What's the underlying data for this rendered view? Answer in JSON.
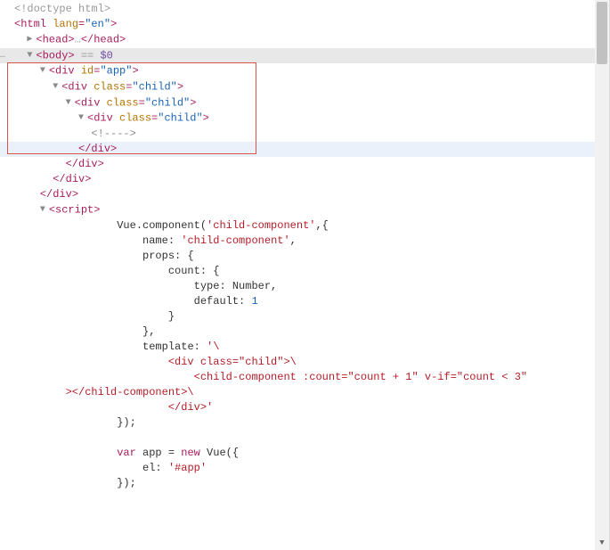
{
  "marker": "…",
  "doctype": "<!doctype html>",
  "html_open": {
    "tag": "html",
    "attr": "lang",
    "val": "\"en\""
  },
  "head": {
    "open": "head",
    "ell": "…",
    "close": "head"
  },
  "body": {
    "tag": "body",
    "eqeq": " == ",
    "var": "$0"
  },
  "div_app": {
    "tag": "div",
    "attr": "id",
    "val": "\"app\""
  },
  "div_child": {
    "tag": "div",
    "attr": "class",
    "val": "\"child\""
  },
  "comment": "<!---->",
  "close_div": "div",
  "script_tag": "script",
  "js": {
    "l1a": "Vue.component(",
    "l1b": "'child-component'",
    "l1c": ",{",
    "l2a": "name: ",
    "l2b": "'child-component'",
    "l2c": ",",
    "l3": "props: {",
    "l4": "count: {",
    "l5a": "type: Number,",
    "l6a": "default: ",
    "l6b": "1",
    "l7": "}",
    "l8": "},",
    "l9a": "template: ",
    "l9b": "'\\",
    "l10": "<div class=\"child\">\\",
    "l11": "<child-component :count=\"count + 1\" v-if=\"count < 3\"",
    "l12": "></child-component>\\",
    "l13": "</div>'",
    "l14": "});",
    "l15a": "var",
    "l15b": " app = ",
    "l15c": "new",
    "l15d": " Vue({",
    "l16a": "el: ",
    "l16b": "'#app'",
    "l17": "});"
  }
}
